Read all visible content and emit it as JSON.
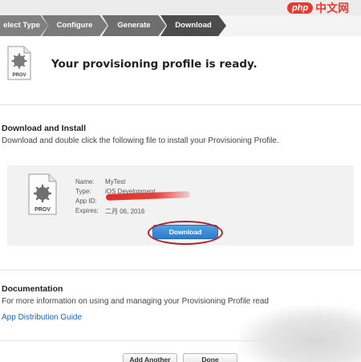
{
  "watermark": {
    "badge": "php",
    "text": "中文网"
  },
  "steps": [
    "elect Type",
    "Configure",
    "Generate",
    "Download"
  ],
  "header": {
    "title": "Your provisioning profile is ready."
  },
  "icon_label": "PROV",
  "download_section": {
    "title": "Download and Install",
    "description": "Download and double click the following file to install your Provisioning Profile."
  },
  "profile": {
    "name_label": "Name:",
    "name_value": "MyTest",
    "type_label": "Type:",
    "type_value": "iOS Development",
    "appid_label": "App ID:",
    "appid_value": "",
    "expires_label": "Expires:",
    "expires_value": "二月 06, 2016"
  },
  "download_button": "Download",
  "documentation": {
    "title": "Documentation",
    "description": "For more information on using and managing your Provisioning Profile read",
    "link": "App Distribution Guide"
  },
  "footer": {
    "add_another": "Add Another",
    "done": "Done"
  },
  "colors": {
    "primary_button": "#2d7cc9",
    "annotation_ring": "#b3222a",
    "link": "#1a63b5",
    "redaction": "#e0342d"
  }
}
